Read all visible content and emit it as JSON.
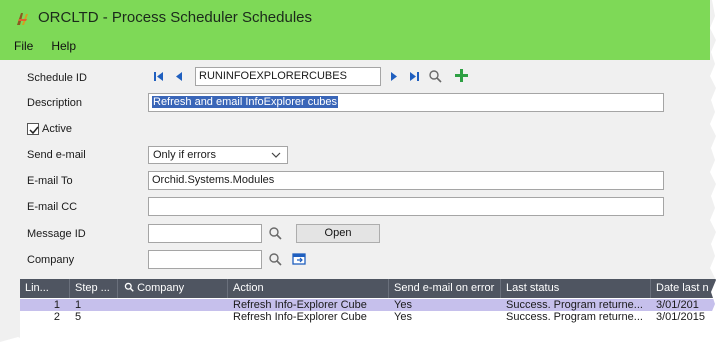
{
  "window": {
    "title": "ORCLTD - Process Scheduler Schedules",
    "menu": [
      "File",
      "Help"
    ]
  },
  "form": {
    "schedule_id_label": "Schedule ID",
    "schedule_id_value": "RUNINFOEXPLORERCUBES",
    "description_label": "Description",
    "description_value": "Refresh and email InfoExplorer cubes",
    "active_label": "Active",
    "active_checked": true,
    "send_email_label": "Send e-mail",
    "send_email_value": "Only if errors",
    "email_to_label": "E-mail To",
    "email_to_value": "Orchid.Systems.Modules",
    "email_cc_label": "E-mail CC",
    "email_cc_value": "",
    "message_id_label": "Message ID",
    "message_id_value": "",
    "open_button": "Open",
    "company_label": "Company",
    "company_value": ""
  },
  "grid": {
    "columns": [
      "Lin...",
      "Step ...",
      "Company",
      "Action",
      "Send e-mail on error",
      "Last status",
      "Date last n"
    ],
    "rows": [
      {
        "line": "1",
        "step": "1",
        "company": "",
        "action": "Refresh Info-Explorer Cube",
        "send": "Yes",
        "status": "Success. Program returne...",
        "date": "3/01/201"
      },
      {
        "line": "2",
        "step": "5",
        "company": "",
        "action": "Refresh Info-Explorer Cube",
        "send": "Yes",
        "status": "Success. Program returne...",
        "date": "3/01/2015"
      }
    ]
  },
  "colors": {
    "title_band": "#7ed957",
    "nav_blue": "#1f5fbf",
    "add_green": "#2ea043",
    "grid_header": "#4f5561",
    "selected_row": "#c6c0ec",
    "text_selection": "#3a66b8"
  },
  "icons": [
    "app-icon",
    "first-record-icon",
    "previous-record-icon",
    "next-record-icon",
    "last-record-icon",
    "search-icon",
    "add-icon",
    "checkmark-icon",
    "chevron-down-icon",
    "finder-icon",
    "zoom-icon"
  ]
}
